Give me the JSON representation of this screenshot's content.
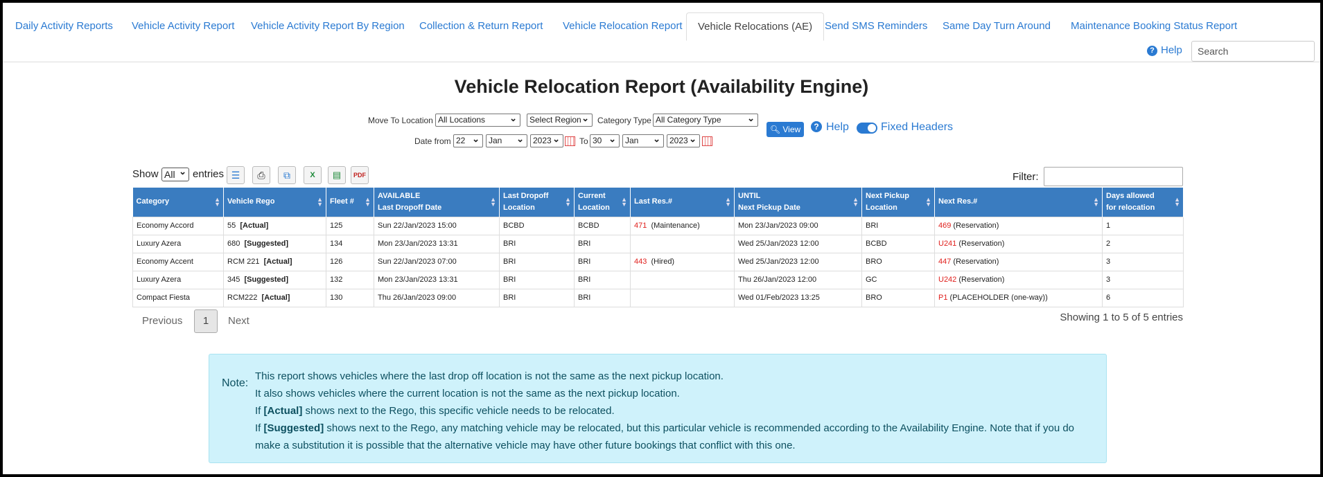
{
  "tabs": [
    {
      "label": "Daily Activity Reports",
      "active": false
    },
    {
      "label": "Vehicle Activity Report",
      "active": false
    },
    {
      "label": "Vehicle Activity Report By Region",
      "active": false
    },
    {
      "label": "Collection & Return Report",
      "active": false
    },
    {
      "label": "Vehicle Relocation Report",
      "active": false
    },
    {
      "label": "Vehicle Relocations (AE)",
      "active": true
    },
    {
      "label": "Send SMS Reminders",
      "active": false
    },
    {
      "label": "Same Day Turn Around",
      "active": false
    },
    {
      "label": "Maintenance Booking Status Report",
      "active": false
    }
  ],
  "header": {
    "help_label": "Help",
    "search_placeholder": "Search"
  },
  "page_title": "Vehicle Relocation Report (Availability Engine)",
  "filters": {
    "move_to_label": "Move To Location",
    "move_to_value": "All Locations",
    "region_value": "Select Region",
    "category_label": "Category Type",
    "category_value": "All Category Type",
    "date_from_label": "Date from",
    "from_day": "22",
    "from_month": "Jan",
    "from_year": "2023",
    "to_label": "To",
    "to_day": "30",
    "to_month": "Jan",
    "to_year": "2023",
    "view_label": "View",
    "help_label": "Help",
    "fixed_headers_label": "Fixed Headers"
  },
  "toolbar": {
    "show_label": "Show",
    "show_value": "All",
    "entries_label": "entries",
    "filter_label": "Filter:"
  },
  "table": {
    "headers": [
      [
        "Category",
        ""
      ],
      [
        "Vehicle Rego",
        ""
      ],
      [
        "Fleet #",
        ""
      ],
      [
        "AVAILABLE",
        "Last Dropoff Date"
      ],
      [
        "Last Dropoff",
        "Location"
      ],
      [
        "Current",
        "Location"
      ],
      [
        "Last Res.#",
        ""
      ],
      [
        "UNTIL",
        "Next Pickup Date"
      ],
      [
        "Next Pickup",
        "Location"
      ],
      [
        "Next Res.#",
        ""
      ],
      [
        "Days allowed",
        "for relocation"
      ]
    ],
    "rows": [
      {
        "category": "Economy Accord",
        "rego": "55",
        "rego_tag": "[Actual]",
        "fleet": "125",
        "last_dropoff_date": "Sun 22/Jan/2023 15:00",
        "last_dropoff_loc": "BCBD",
        "current_loc": "BCBD",
        "last_res_num": "471",
        "last_res_type": "(Maintenance)",
        "next_pickup_date": "Mon 23/Jan/2023 09:00",
        "next_pickup_loc": "BRI",
        "next_res_num": "469",
        "next_res_type": "(Reservation)",
        "days": "1"
      },
      {
        "category": "Luxury Azera",
        "rego": "680",
        "rego_tag": "[Suggested]",
        "fleet": "134",
        "last_dropoff_date": "Mon 23/Jan/2023 13:31",
        "last_dropoff_loc": "BRI",
        "current_loc": "BRI",
        "last_res_num": "",
        "last_res_type": "",
        "next_pickup_date": "Wed 25/Jan/2023 12:00",
        "next_pickup_loc": "BCBD",
        "next_res_num": "U241",
        "next_res_type": "(Reservation)",
        "days": "2"
      },
      {
        "category": "Economy Accent",
        "rego": "RCM 221",
        "rego_tag": "[Actual]",
        "fleet": "126",
        "last_dropoff_date": "Sun 22/Jan/2023 07:00",
        "last_dropoff_loc": "BRI",
        "current_loc": "BRI",
        "last_res_num": "443",
        "last_res_type": "(Hired)",
        "next_pickup_date": "Wed 25/Jan/2023 12:00",
        "next_pickup_loc": "BRO",
        "next_res_num": "447",
        "next_res_type": "(Reservation)",
        "days": "3"
      },
      {
        "category": "Luxury Azera",
        "rego": "345",
        "rego_tag": "[Suggested]",
        "fleet": "132",
        "last_dropoff_date": "Mon 23/Jan/2023 13:31",
        "last_dropoff_loc": "BRI",
        "current_loc": "BRI",
        "last_res_num": "",
        "last_res_type": "",
        "next_pickup_date": "Thu 26/Jan/2023 12:00",
        "next_pickup_loc": "GC",
        "next_res_num": "U242",
        "next_res_type": "(Reservation)",
        "days": "3"
      },
      {
        "category": "Compact Fiesta",
        "rego": "RCM222",
        "rego_tag": "[Actual]",
        "fleet": "130",
        "last_dropoff_date": "Thu 26/Jan/2023 09:00",
        "last_dropoff_loc": "BRI",
        "current_loc": "BRI",
        "last_res_num": "",
        "last_res_type": "",
        "next_pickup_date": "Wed 01/Feb/2023 13:25",
        "next_pickup_loc": "BRO",
        "next_res_num": "P1",
        "next_res_type": "(PLACEHOLDER (one-way))",
        "days": "6"
      }
    ]
  },
  "pagination": {
    "previous": "Previous",
    "page": "1",
    "next": "Next",
    "summary": "Showing 1 to 5 of 5 entries"
  },
  "note": {
    "label": "Note:",
    "line1": "This report shows vehicles where the last drop off location is not the same as the next pickup location.",
    "line2": "It also shows vehicles where the current location is not the same as the next pickup location.",
    "line3_pre": "If ",
    "line3_bold": "[Actual]",
    "line3_post": " shows next to the Rego, this specific vehicle needs to be relocated.",
    "line4_pre": "If ",
    "line4_bold": "[Suggested]",
    "line4_post": " shows next to the Rego, any matching vehicle may be relocated, but this particular vehicle is recommended according to the Availability Engine. Note that if you do make a substitution it is possible that the alternative vehicle may have other future bookings that conflict with this one."
  },
  "colors": {
    "accent": "#2a7ad2",
    "table_header": "#3a7cc0",
    "res_red": "#e0201d",
    "note_bg": "#cff2fb"
  },
  "icons": [
    "question-icon",
    "calendar-icon",
    "search-icon",
    "list-icon",
    "print-icon",
    "copy-icon",
    "excel-icon",
    "csv-icon",
    "pdf-icon",
    "sort-icon"
  ]
}
